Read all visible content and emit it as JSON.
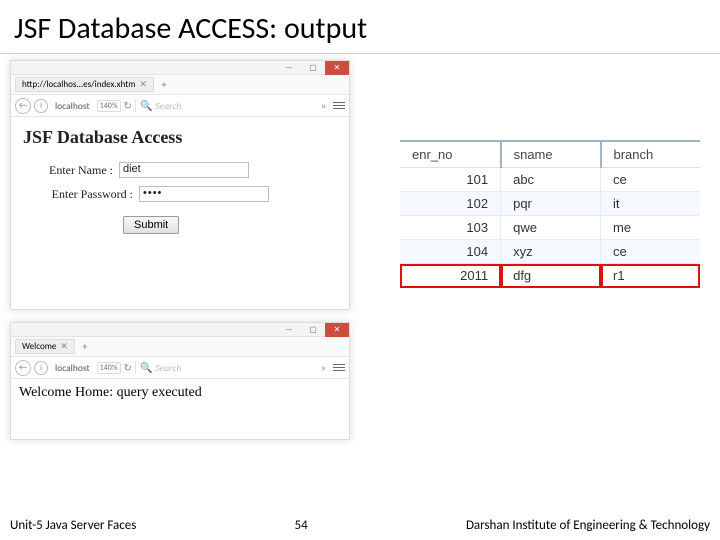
{
  "title": "JSF Database ACCESS: output",
  "window1": {
    "tab_label": "http://localhos...es/index.xhtm",
    "url": "localhost",
    "zoom": "140%",
    "search_ph": "Search",
    "heading": "JSF Database Access",
    "name_label": "Enter Name :",
    "name_value": "diet",
    "pass_label": "Enter Password :",
    "pass_value": "••••",
    "submit": "Submit"
  },
  "window2": {
    "tab_label": "Welcome",
    "url": "localhost",
    "zoom": "140%",
    "search_ph": "Search",
    "body": "Welcome Home: query executed"
  },
  "table": {
    "headers": [
      "enr_no",
      "sname",
      "branch"
    ],
    "rows": [
      {
        "enr_no": "101",
        "sname": "abc",
        "branch": "ce"
      },
      {
        "enr_no": "102",
        "sname": "pqr",
        "branch": "it"
      },
      {
        "enr_no": "103",
        "sname": "qwe",
        "branch": "me"
      },
      {
        "enr_no": "104",
        "sname": "xyz",
        "branch": "ce"
      },
      {
        "enr_no": "2011",
        "sname": "dfg",
        "branch": "r1"
      }
    ]
  },
  "footer": {
    "left": "Unit-5 Java Server Faces",
    "num": "54",
    "right": "Darshan Institute of Engineering & Technology"
  }
}
